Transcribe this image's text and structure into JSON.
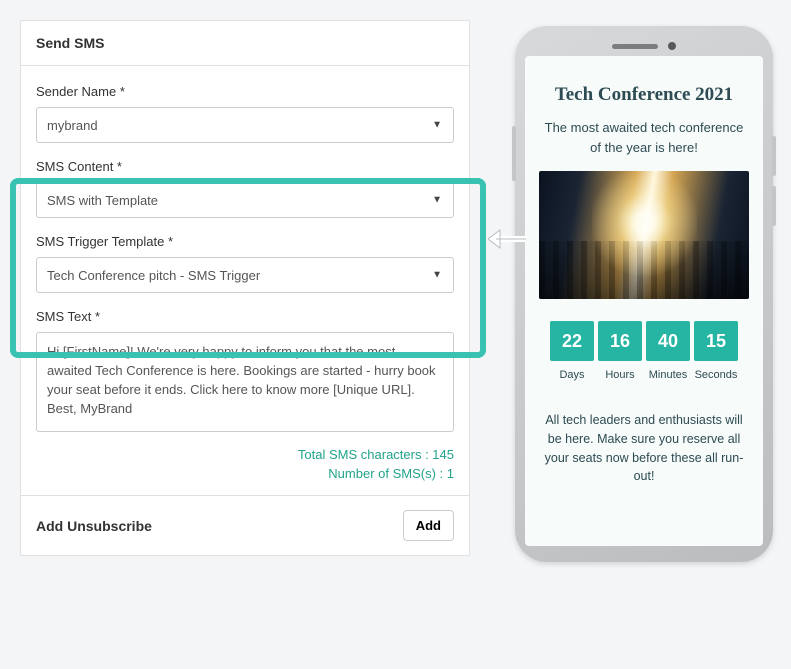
{
  "panel": {
    "title": "Send SMS",
    "senderLabel": "Sender Name *",
    "senderValue": "mybrand",
    "contentLabel": "SMS Content *",
    "contentValue": "SMS with Template",
    "triggerLabel": "SMS Trigger Template *",
    "triggerValue": "Tech Conference pitch - SMS Trigger",
    "textLabel": "SMS Text *",
    "textValue": "Hi [FirstName]! We're very happy to inform you that the most awaited Tech Conference is here. Bookings are started - hurry book your seat before it ends. Click here to know more [Unique URL]. Best, MyBrand",
    "charCountLabel": "Total SMS characters : 145",
    "smsCountLabel": "Number of SMS(s) : 1",
    "footerTitle": "Add Unsubscribe",
    "addBtn": "Add"
  },
  "phone": {
    "title": "Tech Conference 2021",
    "subtitle": "The most awaited tech conference of the year is here!",
    "countdown": {
      "days": "22",
      "hours": "16",
      "minutes": "40",
      "seconds": "15",
      "labels": {
        "days": "Days",
        "hours": "Hours",
        "minutes": "Minutes",
        "seconds": "Seconds"
      }
    },
    "body": "All tech leaders and enthusiasts will be here. Make sure you reserve all your seats now before these all run-out!"
  }
}
